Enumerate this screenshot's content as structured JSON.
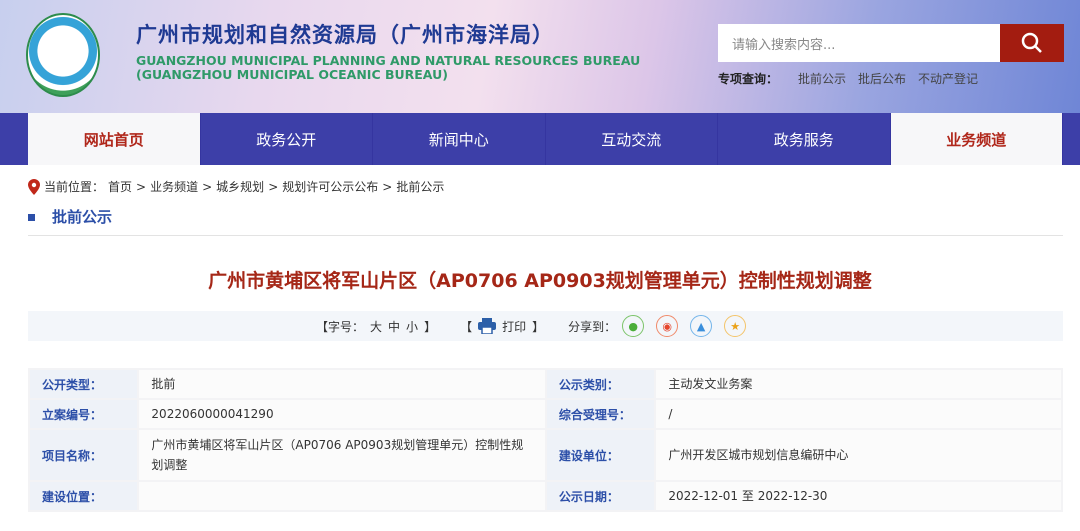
{
  "header": {
    "title_cn": "广州市规划和自然资源局（广州市海洋局）",
    "title_en_1": "GUANGZHOU MUNICIPAL PLANNING AND NATURAL RESOURCES BUREAU",
    "title_en_2": "(GUANGZHOU MUNICIPAL OCEANIC BUREAU)",
    "search_placeholder": "请输入搜索内容...",
    "quick_label": "专项查询：",
    "quick_links": [
      "批前公示",
      "批后公布",
      "不动产登记"
    ]
  },
  "nav": [
    "网站首页",
    "政务公开",
    "新闻中心",
    "互动交流",
    "政务服务",
    "业务频道"
  ],
  "breadcrumb": {
    "label": "当前位置：",
    "items": [
      "首页",
      ">",
      "业务频道",
      ">",
      "城乡规划",
      ">",
      "规划许可公示公布",
      ">",
      "批前公示"
    ]
  },
  "section_title": "批前公示",
  "article_title": "广州市黄埔区将军山片区（AP0706 AP0903规划管理单元）控制性规划调整",
  "toolbar": {
    "font_label": "【字号：",
    "large": "大",
    "medium": "中",
    "small": "小",
    "close": "】",
    "print_open": "【",
    "print": "打印",
    "print_close": "】",
    "share": "分享到："
  },
  "table": [
    {
      "l1": "公开类型：",
      "v1": "批前",
      "l2": "公示类别：",
      "v2": "主动发文业务案"
    },
    {
      "l1": "立案编号：",
      "v1": "2022060000041290",
      "l2": "综合受理号：",
      "v2": "/"
    },
    {
      "l1": "项目名称：",
      "v1": "广州市黄埔区将军山片区（AP0706 AP0903规划管理单元）控制性规划调整",
      "l2": "建设单位：",
      "v2": "广州开发区城市规划信息编研中心"
    },
    {
      "l1": "建设位置：",
      "v1": "",
      "l2": "公示日期：",
      "v2": "2022-12-01 至 2022-12-30"
    }
  ]
}
